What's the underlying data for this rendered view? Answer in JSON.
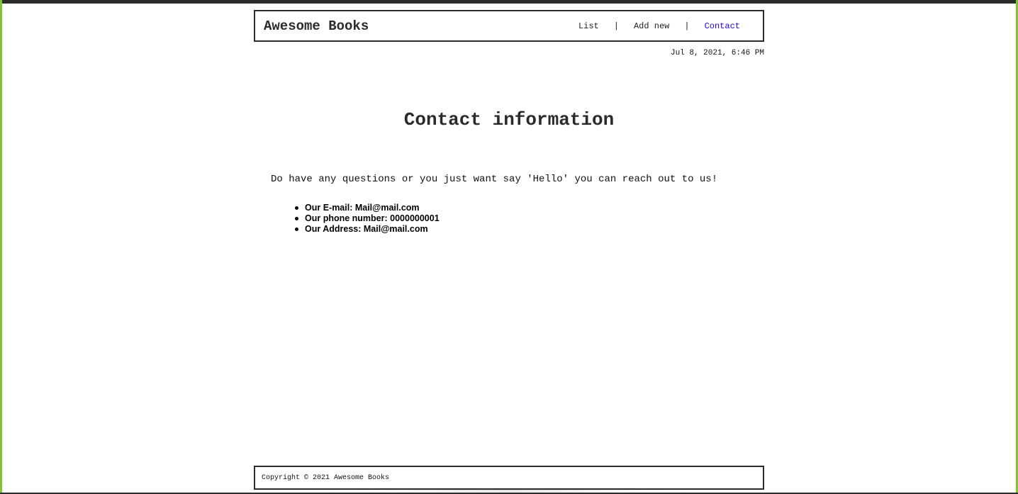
{
  "header": {
    "brand": "Awesome Books",
    "nav": {
      "list": "List",
      "add_new": "Add new",
      "contact": "Contact",
      "separator": "|"
    }
  },
  "datetime": "Jul 8, 2021, 6:46 PM",
  "contact": {
    "title": "Contact information",
    "intro": "Do have any questions or you just want say 'Hello' you can reach out to us!",
    "items": [
      "Our E-mail: Mail@mail.com",
      "Our phone number: 0000000001",
      "Our Address: Mail@mail.com"
    ]
  },
  "footer": {
    "copyright": "Copyright © 2021 Awesome Books"
  },
  "colors": {
    "frame_green": "#7dc832",
    "border": "#2b2b2b",
    "active_link": "#2200dd"
  }
}
